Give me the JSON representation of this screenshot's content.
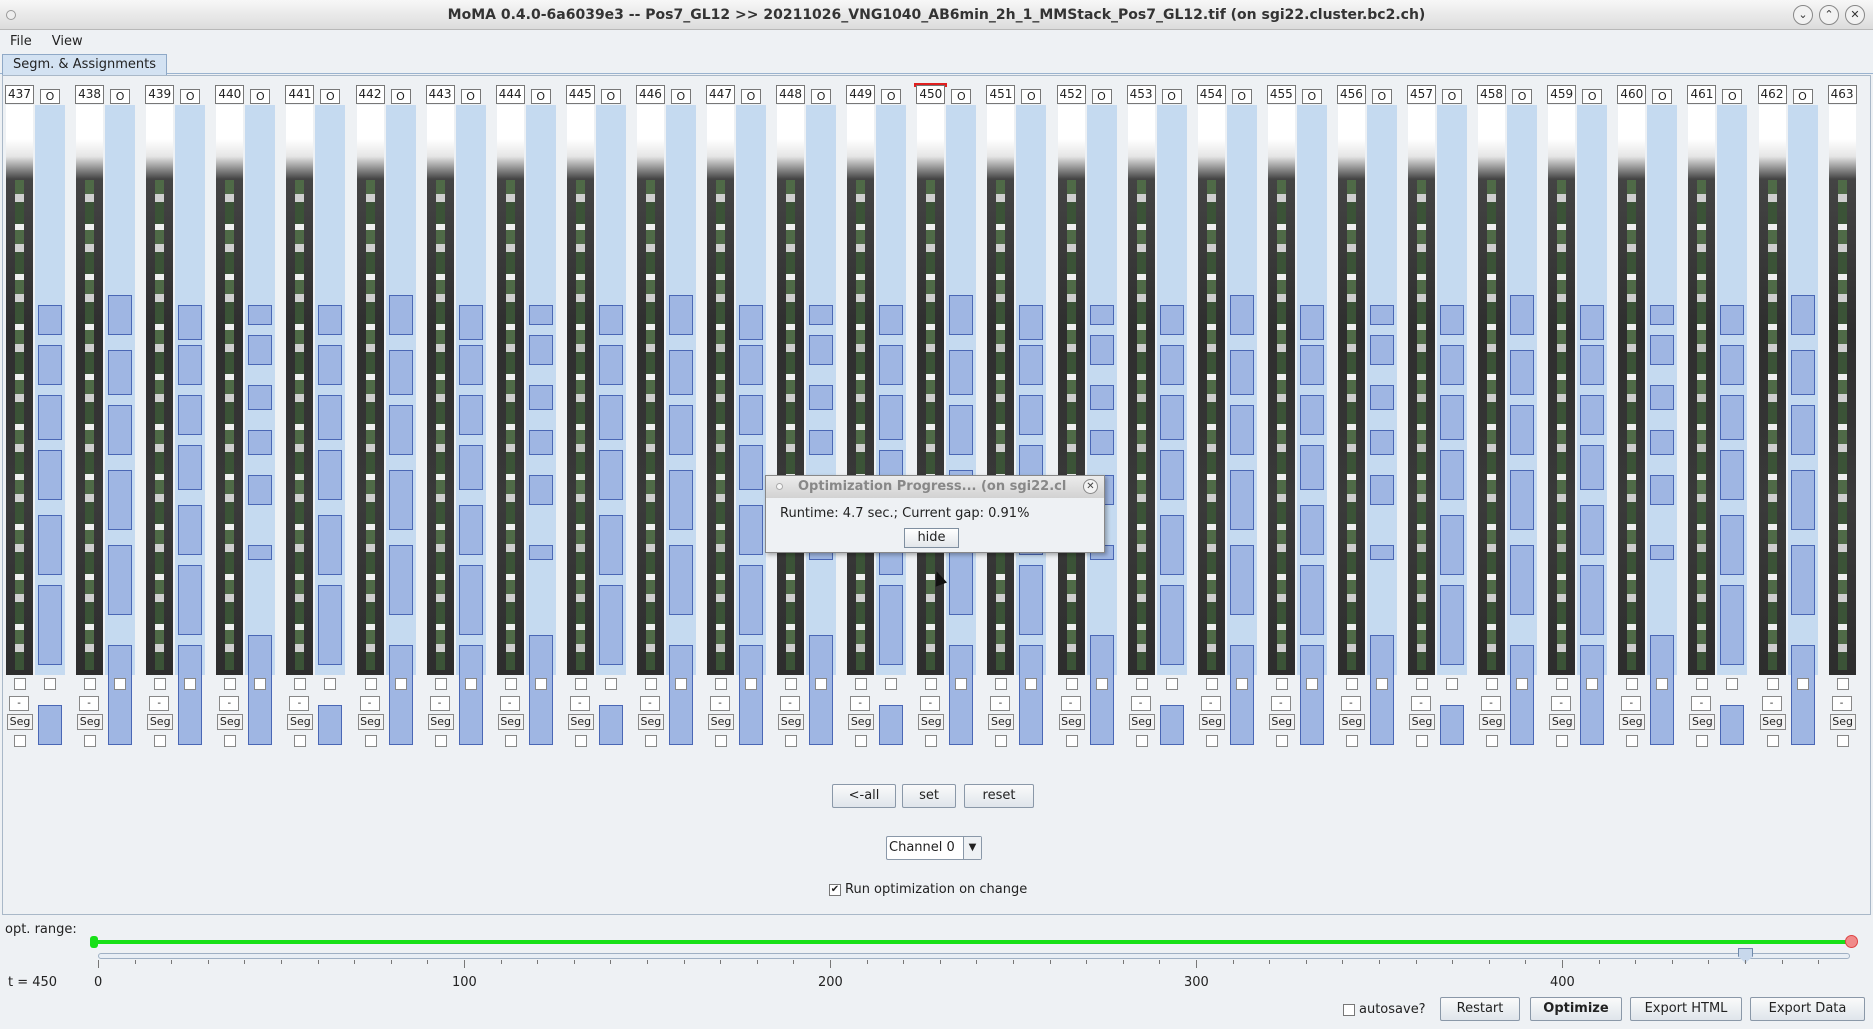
{
  "window": {
    "title": "MoMA 0.4.0-6a6039e3 -- Pos7_GL12 >> 20211026_VNG1040_AB6min_2h_1_MMStack_Pos7_GL12.tif (on sgi22.cluster.bc2.ch)",
    "buttons": [
      "⌄",
      "⌃",
      "✕"
    ]
  },
  "menu": {
    "file": "File",
    "view": "View"
  },
  "tab": {
    "label": "Segm. & Assignments"
  },
  "frames": [
    "437",
    "438",
    "439",
    "440",
    "441",
    "442",
    "443",
    "444",
    "445",
    "446",
    "447",
    "448",
    "449",
    "450",
    "451",
    "452",
    "453",
    "454",
    "455",
    "456",
    "457",
    "458",
    "459",
    "460",
    "461",
    "462",
    "463"
  ],
  "selected_frame": "450",
  "column_controls": {
    "minus": "-",
    "seg": "Seg",
    "gap_label": "O"
  },
  "controls": {
    "all": "<-all",
    "set": "set",
    "reset": "reset",
    "channel": "Channel 0",
    "run_opt": "Run optimization on change",
    "run_opt_checked": true
  },
  "dialog": {
    "title": "Optimization Progress... (on sgi22.cl",
    "message": "Runtime: 4.7 sec.; Current gap: 0.91%",
    "hide": "hide"
  },
  "bottom": {
    "opt_range": "opt. range:",
    "t_label": "t = 450",
    "ticks": [
      "0",
      "100",
      "200",
      "300",
      "400"
    ],
    "autosave": "autosave?",
    "restart": "Restart",
    "optimize": "Optimize",
    "export_html": "Export HTML",
    "export_data": "Export Data"
  },
  "colors": {
    "accent_green": "#17e017",
    "selected": "#e02020",
    "segment_fill": "#9fb6e3",
    "segment_border": "#4a67b5",
    "gap_bg": "#c5daf0"
  }
}
